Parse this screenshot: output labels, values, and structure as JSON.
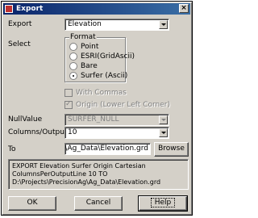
{
  "window": {
    "title": "Export",
    "close_glyph": "×",
    "icon": "app-icon"
  },
  "export": {
    "label": "Export",
    "value": "Elevation"
  },
  "select": {
    "label": "Select",
    "format_group_label": "Format",
    "options": [
      {
        "label": "Point",
        "selected": false
      },
      {
        "label": "ESRI(GridAscii)",
        "selected": false
      },
      {
        "label": "Bare",
        "selected": false
      },
      {
        "label": "Surfer (Ascii)",
        "selected": true
      }
    ]
  },
  "with_commas": {
    "label": "With Commas",
    "checked": false,
    "enabled": false
  },
  "origin": {
    "label": "Origin (Lower Left Corner)",
    "checked": true,
    "enabled": false
  },
  "null_value": {
    "label": "NullValue",
    "value": "SURFER_NULL"
  },
  "columns_per_output_line": {
    "label": "Columns/OutputLine",
    "value": "10"
  },
  "to": {
    "label": "To",
    "value": "cisionAg\\Ag_Data\\Elevation.grd",
    "browse_label": "Browse"
  },
  "command_preview": "EXPORT Elevation Surfer Origin Cartesian ColumnsPerOutputLine 10 TO D:\\Projects\\PrecisionAg\\Ag_Data\\Elevation.grd",
  "buttons": {
    "ok": "OK",
    "cancel": "Cancel",
    "help": "Help"
  }
}
